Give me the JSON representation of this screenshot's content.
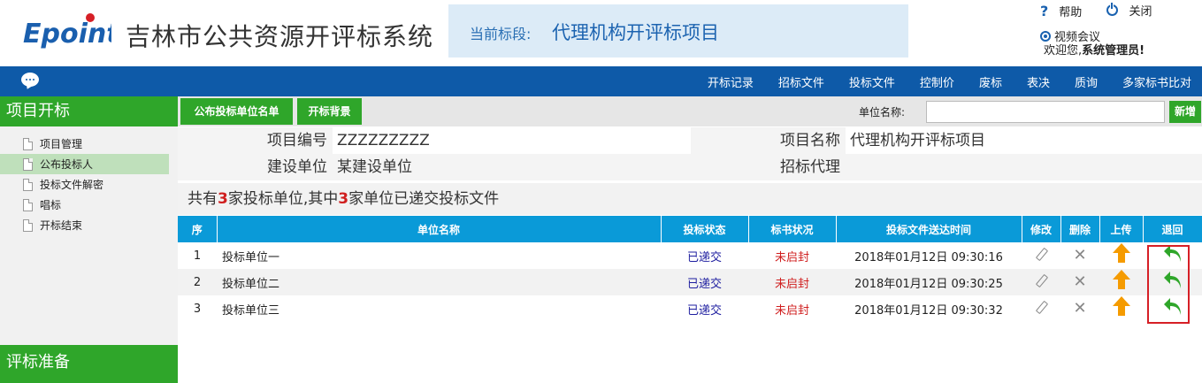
{
  "header": {
    "logo_text": "Epoint",
    "system_title": "吉林市公共资源开评标系统",
    "stage_label": "当前标段:",
    "stage_value": "代理机构开评标项目",
    "help": "帮助",
    "close": "关闭",
    "video": "视频会议",
    "welcome_prefix": "欢迎您,",
    "welcome_user": "系统管理员!"
  },
  "nav": {
    "items": [
      "开标记录",
      "招标文件",
      "投标文件",
      "控制价",
      "废标",
      "表决",
      "质询",
      "多家标书比对"
    ]
  },
  "sidebar": {
    "section_title": "项目开标",
    "items": [
      {
        "label": "项目管理"
      },
      {
        "label": "公布投标人"
      },
      {
        "label": "投标文件解密"
      },
      {
        "label": "唱标"
      },
      {
        "label": "开标结束"
      }
    ],
    "footer_title": "评标准备"
  },
  "toolbar": {
    "tab1": "公布投标单位名单",
    "tab2": "开标背景",
    "unit_label": "单位名称:",
    "unit_value": "",
    "add": "新增"
  },
  "info": {
    "project_no_label": "项目编号",
    "project_no": "ZZZZZZZZZ",
    "project_name_label": "项目名称",
    "project_name": "代理机构开评标项目",
    "builder_label": "建设单位",
    "builder": "某建设单位",
    "agency_label": "招标代理",
    "agency": ""
  },
  "summary": {
    "prefix": "共有",
    "total": "3",
    "middle": "家投标单位,其中",
    "submitted": "3",
    "suffix": "家单位已递交投标文件"
  },
  "grid": {
    "headers": [
      "序",
      "单位名称",
      "投标状态",
      "标书状况",
      "投标文件送达时间",
      "修改",
      "删除",
      "上传",
      "退回"
    ],
    "rows": [
      {
        "no": "1",
        "name": "投标单位一",
        "status": "已递交",
        "bid": "未启封",
        "time": "2018年01月12日 09:30:16"
      },
      {
        "no": "2",
        "name": "投标单位二",
        "status": "已递交",
        "bid": "未启封",
        "time": "2018年01月12日 09:30:25"
      },
      {
        "no": "3",
        "name": "投标单位三",
        "status": "已递交",
        "bid": "未启封",
        "time": "2018年01月12日 09:30:32"
      }
    ]
  },
  "colors": {
    "primary_blue": "#0e5aa8",
    "table_header": "#0a9ad8",
    "green": "#2fa62a",
    "red": "#d01f1f"
  }
}
